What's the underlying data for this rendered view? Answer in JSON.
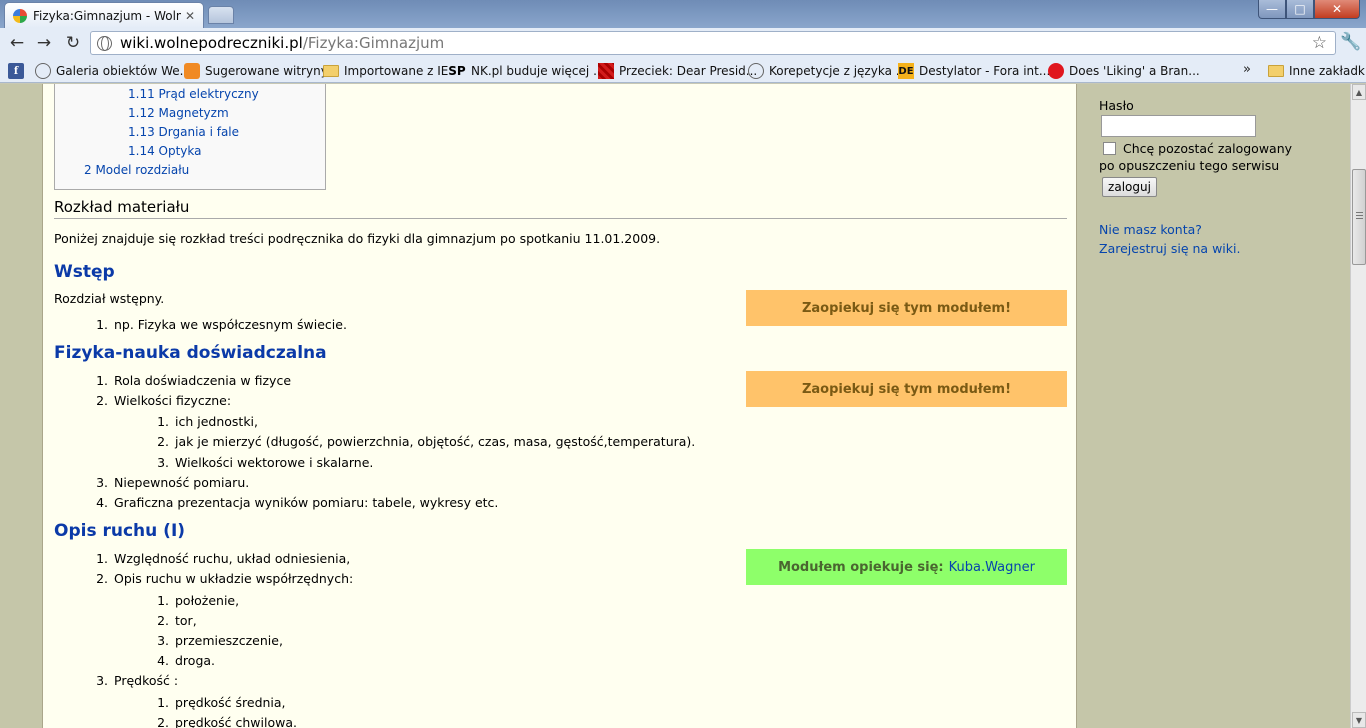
{
  "browser": {
    "tab_title": "Fizyka:Gimnazjum - Wolne",
    "tab_close": "✕",
    "url_host": "wiki.wolnepodreczniki.pl",
    "url_path": "/Fizyka:Gimnazjum",
    "nav": {
      "back": "←",
      "forward": "→",
      "reload": "↻"
    },
    "star": "☆",
    "wrench": "🔧",
    "win": {
      "min": "—",
      "max": "□",
      "close": "✕"
    }
  },
  "bookmarks": [
    {
      "label": "Galeria obiektów We...",
      "icon": "globe-icon"
    },
    {
      "label": "Sugerowane witryny",
      "icon": "orange-icon"
    },
    {
      "label": "Importowane z IE",
      "icon": "folder-icon"
    },
    {
      "label": "NK.pl buduje więcej ...",
      "icon": "sp-icon",
      "icon_text": "SP"
    },
    {
      "label": "Przeciek: Dear Presid...",
      "icon": "red-icon"
    },
    {
      "label": "Korepetycje z języka ...",
      "icon": "globe-icon"
    },
    {
      "label": "Destylator - Fora int...",
      "icon": "de-icon",
      "icon_text": "DE"
    },
    {
      "label": "Does 'Liking' a Bran...",
      "icon": "red-circle-icon"
    },
    {
      "label": "Inne zakładki",
      "icon": "folder-icon"
    }
  ],
  "bookmarks_more": "»",
  "toc": [
    "1.11 Prąd elektryczny",
    "1.12 Magnetyzm",
    "1.13 Drgania i fale",
    "1.14 Optyka",
    "2 Model rozdziału"
  ],
  "section_title": "Rozkład materiału",
  "intro": "Poniżej znajduje się rozkład treści podręcznika do fizyki dla gimnazjum po spotkaniu 11.01.2009.",
  "wstep": {
    "title": "Wstęp",
    "text": "Rozdział wstępny.",
    "items": [
      "np. Fizyka we współczesnym świecie."
    ],
    "box": "Zaopiekuj się tym modułem!"
  },
  "fizyka": {
    "title": "Fizyka-nauka doświadczalna",
    "items": [
      "Rola doświadczenia w fizyce",
      "Wielkości fizyczne:",
      "ich jednostki,",
      "jak je mierzyć (długość, powierzchnia, objętość, czas, masa, gęstość,temperatura).",
      "Wielkości wektorowe i skalarne.",
      "Niepewność pomiaru.",
      "Graficzna prezentacja wyników pomiaru: tabele, wykresy etc."
    ],
    "box": "Zaopiekuj się tym modułem!"
  },
  "opis": {
    "title": "Opis ruchu (I)",
    "items": [
      "Względność ruchu, układ odniesienia,",
      "Opis ruchu w układzie współrzędnych:",
      "położenie,",
      "tor,",
      "przemieszczenie,",
      "droga.",
      "Prędkość :",
      "prędkość średnia,",
      "prędkość chwilowa."
    ],
    "box_text": "Modułem opiekuje się:",
    "box_user": "Kuba.Wagner"
  },
  "sidebar": {
    "password_label": "Hasło",
    "remember_line1": "Chcę pozostać zalogowany",
    "remember_line2": "po opuszczeniu tego serwisu",
    "login_button": "zaloguj",
    "no_account": "Nie masz konta?",
    "register": "Zarejestruj się na wiki."
  }
}
